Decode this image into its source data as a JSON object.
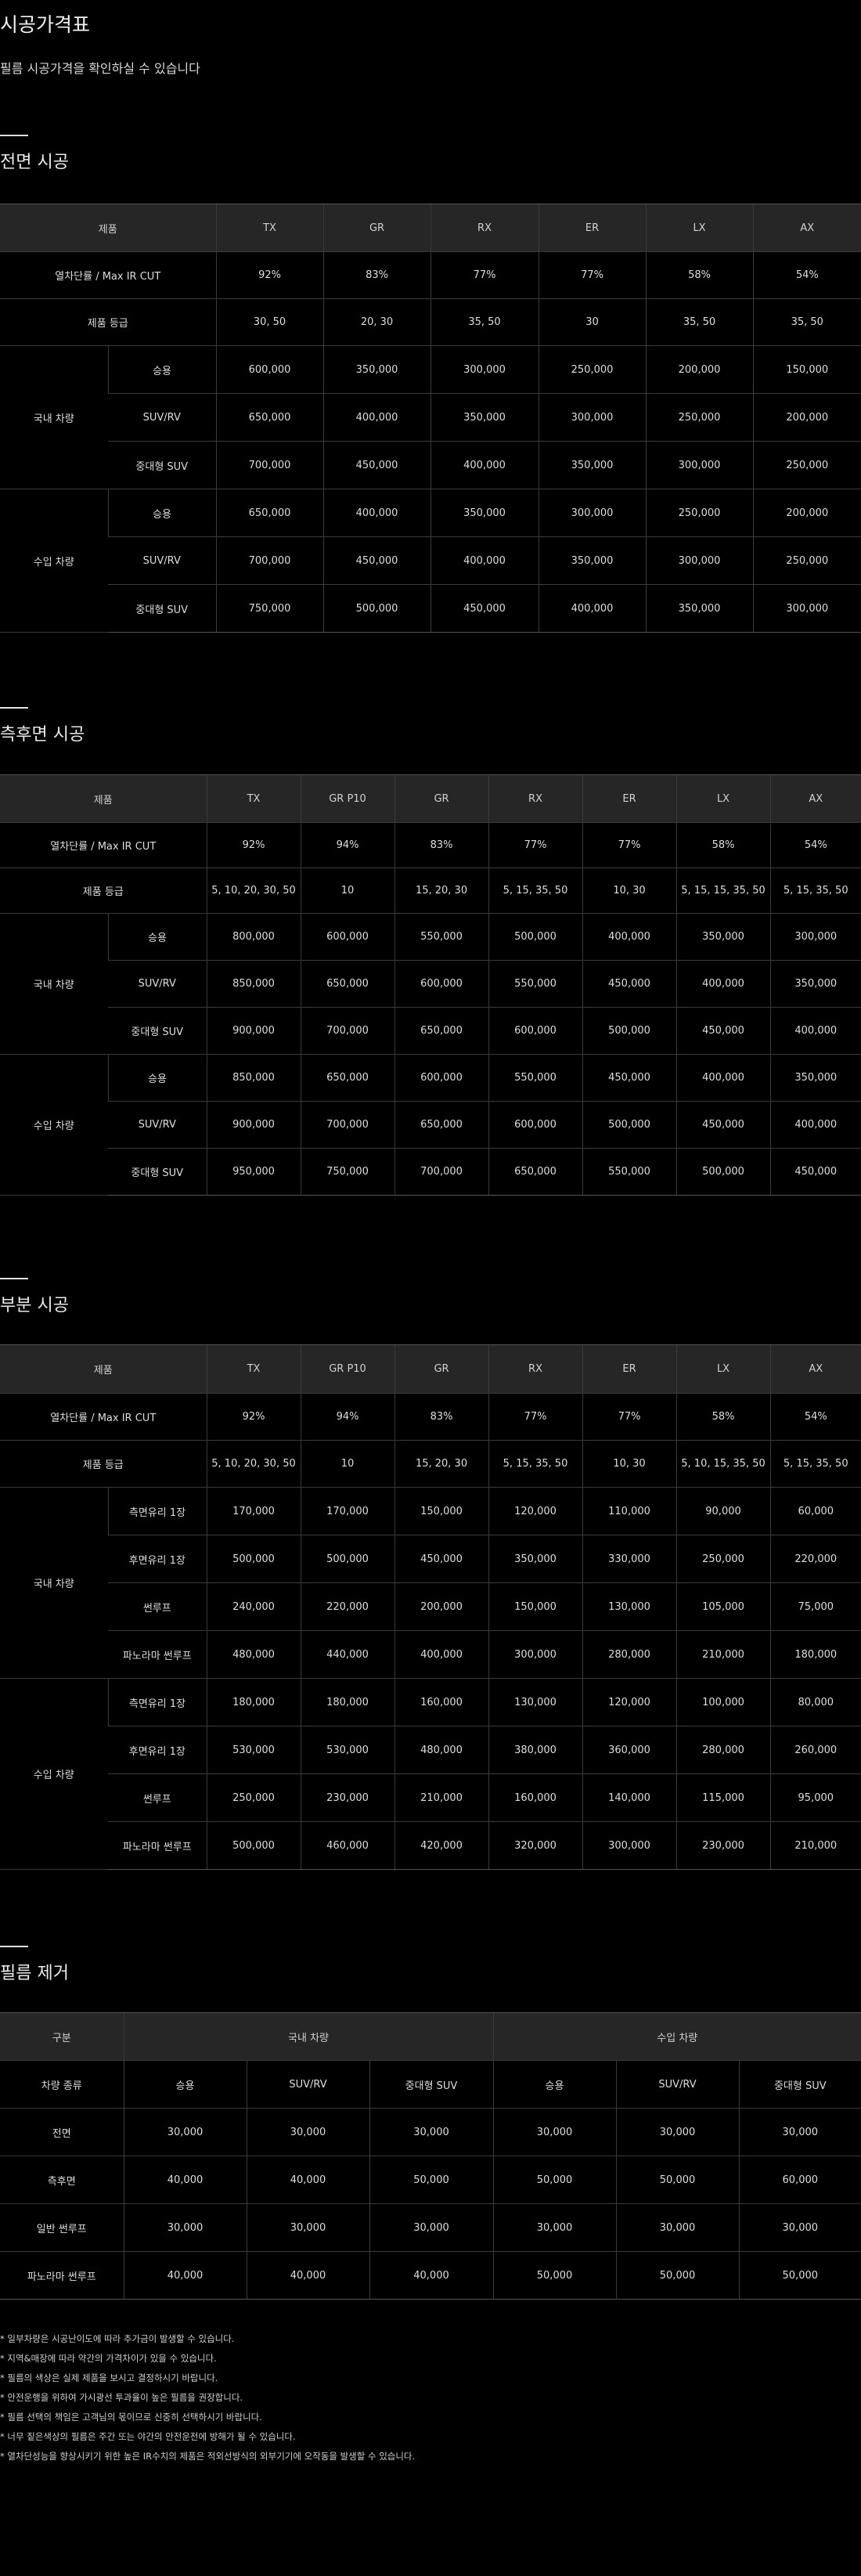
{
  "page": {
    "title": "시공가격표",
    "subtitle": "필름 시공가격을 확인하실 수 있습니다"
  },
  "front": {
    "title": "전면 시공",
    "head": [
      "제품",
      "TX",
      "GR",
      "RX",
      "ER",
      "LX",
      "AX"
    ],
    "spec_rows": [
      {
        "label": "열차단률 / Max IR CUT",
        "values": [
          "92%",
          "83%",
          "77%",
          "77%",
          "58%",
          "54%"
        ]
      },
      {
        "label": "제품 등급",
        "values": [
          "30, 50",
          "20, 30",
          "35, 50",
          "30",
          "35, 50",
          "35, 50"
        ]
      }
    ],
    "groups": [
      {
        "name": "국내 차량",
        "rows": [
          {
            "label": "승용",
            "values": [
              "600,000",
              "350,000",
              "300,000",
              "250,000",
              "200,000",
              "150,000"
            ]
          },
          {
            "label": "SUV/RV",
            "values": [
              "650,000",
              "400,000",
              "350,000",
              "300,000",
              "250,000",
              "200,000"
            ]
          },
          {
            "label": "중대형 SUV",
            "values": [
              "700,000",
              "450,000",
              "400,000",
              "350,000",
              "300,000",
              "250,000"
            ]
          }
        ]
      },
      {
        "name": "수입 차량",
        "rows": [
          {
            "label": "승용",
            "values": [
              "650,000",
              "400,000",
              "350,000",
              "300,000",
              "250,000",
              "200,000"
            ]
          },
          {
            "label": "SUV/RV",
            "values": [
              "700,000",
              "450,000",
              "400,000",
              "350,000",
              "300,000",
              "250,000"
            ]
          },
          {
            "label": "중대형 SUV",
            "values": [
              "750,000",
              "500,000",
              "450,000",
              "400,000",
              "350,000",
              "300,000"
            ]
          }
        ]
      }
    ]
  },
  "side": {
    "title": "측후면 시공",
    "head": [
      "제품",
      "TX",
      "GR P10",
      "GR",
      "RX",
      "ER",
      "LX",
      "AX"
    ],
    "spec_rows": [
      {
        "label": "열차단률 / Max IR CUT",
        "values": [
          "92%",
          "94%",
          "83%",
          "77%",
          "77%",
          "58%",
          "54%"
        ]
      },
      {
        "label": "제품 등급",
        "values": [
          "5, 10, 20, 30, 50",
          "10",
          "15, 20, 30",
          "5, 15, 35, 50",
          "10, 30",
          "5, 15, 15, 35, 50",
          "5, 15, 35, 50"
        ]
      }
    ],
    "groups": [
      {
        "name": "국내 차량",
        "rows": [
          {
            "label": "승용",
            "values": [
              "800,000",
              "600,000",
              "550,000",
              "500,000",
              "400,000",
              "350,000",
              "300,000"
            ]
          },
          {
            "label": "SUV/RV",
            "values": [
              "850,000",
              "650,000",
              "600,000",
              "550,000",
              "450,000",
              "400,000",
              "350,000"
            ]
          },
          {
            "label": "중대형 SUV",
            "values": [
              "900,000",
              "700,000",
              "650,000",
              "600,000",
              "500,000",
              "450,000",
              "400,000"
            ]
          }
        ]
      },
      {
        "name": "수입 차량",
        "rows": [
          {
            "label": "승용",
            "values": [
              "850,000",
              "650,000",
              "600,000",
              "550,000",
              "450,000",
              "400,000",
              "350,000"
            ]
          },
          {
            "label": "SUV/RV",
            "values": [
              "900,000",
              "700,000",
              "650,000",
              "600,000",
              "500,000",
              "450,000",
              "400,000"
            ]
          },
          {
            "label": "중대형 SUV",
            "values": [
              "950,000",
              "750,000",
              "700,000",
              "650,000",
              "550,000",
              "500,000",
              "450,000"
            ]
          }
        ]
      }
    ]
  },
  "partial": {
    "title": "부분 시공",
    "head": [
      "제품",
      "TX",
      "GR P10",
      "GR",
      "RX",
      "ER",
      "LX",
      "AX"
    ],
    "spec_rows": [
      {
        "label": "열차단률 / Max IR CUT",
        "values": [
          "92%",
          "94%",
          "83%",
          "77%",
          "77%",
          "58%",
          "54%"
        ]
      },
      {
        "label": "제품 등급",
        "values": [
          "5, 10, 20, 30, 50",
          "10",
          "15, 20, 30",
          "5, 15, 35, 50",
          "10, 30",
          "5, 10, 15, 35, 50",
          "5, 15, 35, 50"
        ]
      }
    ],
    "groups": [
      {
        "name": "국내 차량",
        "rows": [
          {
            "label": "측면유리 1장",
            "values": [
              "170,000",
              "170,000",
              "150,000",
              "120,000",
              "110,000",
              "90,000",
              "60,000"
            ]
          },
          {
            "label": "후면유리 1장",
            "values": [
              "500,000",
              "500,000",
              "450,000",
              "350,000",
              "330,000",
              "250,000",
              "220,000"
            ]
          },
          {
            "label": "썬루프",
            "values": [
              "240,000",
              "220,000",
              "200,000",
              "150,000",
              "130,000",
              "105,000",
              "75,000"
            ]
          },
          {
            "label": "파노라마 썬루프",
            "values": [
              "480,000",
              "440,000",
              "400,000",
              "300,000",
              "280,000",
              "210,000",
              "180,000"
            ]
          }
        ]
      },
      {
        "name": "수입 차량",
        "rows": [
          {
            "label": "측면유리 1장",
            "values": [
              "180,000",
              "180,000",
              "160,000",
              "130,000",
              "120,000",
              "100,000",
              "80,000"
            ]
          },
          {
            "label": "후면유리 1장",
            "values": [
              "530,000",
              "530,000",
              "480,000",
              "380,000",
              "360,000",
              "280,000",
              "260,000"
            ]
          },
          {
            "label": "썬루프",
            "values": [
              "250,000",
              "230,000",
              "210,000",
              "160,000",
              "140,000",
              "115,000",
              "95,000"
            ]
          },
          {
            "label": "파노라마 썬루프",
            "values": [
              "500,000",
              "460,000",
              "420,000",
              "320,000",
              "300,000",
              "230,000",
              "210,000"
            ]
          }
        ]
      }
    ]
  },
  "removal": {
    "title": "필름 제거",
    "head_group": {
      "label": "구분",
      "domestic": "국내 차량",
      "imported": "수입 차량"
    },
    "sub_head": {
      "label": "차량 종류",
      "types": [
        "승용",
        "SUV/RV",
        "중대형 SUV",
        "승용",
        "SUV/RV",
        "중대형 SUV"
      ]
    },
    "rows": [
      {
        "label": "전면",
        "values": [
          "30,000",
          "30,000",
          "30,000",
          "30,000",
          "30,000",
          "30,000"
        ]
      },
      {
        "label": "측후면",
        "values": [
          "40,000",
          "40,000",
          "50,000",
          "50,000",
          "50,000",
          "60,000"
        ]
      },
      {
        "label": "일반 썬루프",
        "values": [
          "30,000",
          "30,000",
          "30,000",
          "30,000",
          "30,000",
          "30,000"
        ]
      },
      {
        "label": "파노라마 썬루프",
        "values": [
          "40,000",
          "40,000",
          "40,000",
          "50,000",
          "50,000",
          "50,000"
        ]
      }
    ]
  },
  "notes": [
    "* 일부차량은 시공난이도에 따라 추가금이 발생할 수 있습니다.",
    "* 지역&매장에 따라 약간의 가격차이가 있을 수 있습니다.",
    "* 필름의 색상은 실제 제품을 보시고 결정하시기 바랍니다.",
    "* 안전운행을 위하여 가시광선 투과율이 높은 필름을 권장합니다.",
    "* 필름 선택의 책임은 고객님의 몫이므로 신중히 선택하시기 바랍니다.",
    "* 너무 짙은색상의 필름은 주간 또는 야간의 안전운전에 방해가 될 수 있습니다.",
    "* 열차단성능을 향상시키기 위한 높은 IR수치의 제품은 적외선방식의 외부기기에 오작동을 발생할 수 있습니다."
  ]
}
